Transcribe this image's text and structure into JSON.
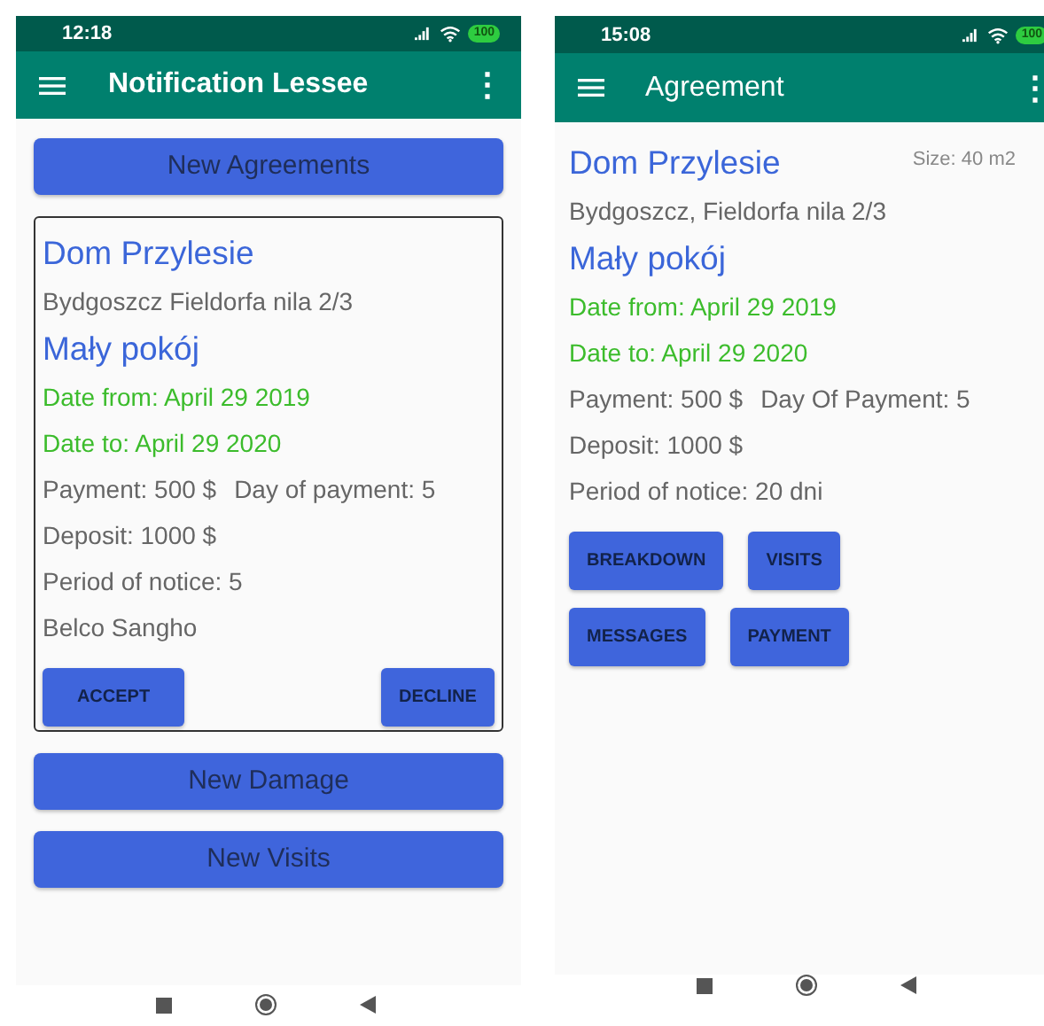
{
  "screens": [
    {
      "kind": "notification",
      "status": {
        "time": "12:18",
        "battery": "100"
      },
      "title": "Notification Lessee",
      "more": "⋮",
      "content": [
        {
          "kind": "wide_button",
          "label": "New Agreements"
        },
        {
          "kind": "card",
          "lines": [
            {
              "kind": "heading",
              "texts": [
                "Dom Przylesie"
              ]
            },
            {
              "kind": "text",
              "texts": [
                "Bydgoszcz Fieldorfa nila 2/3"
              ]
            },
            {
              "kind": "heading",
              "texts": [
                "Mały pokój"
              ]
            },
            {
              "kind": "date",
              "texts": [
                "Date from: April 29 2019"
              ]
            },
            {
              "kind": "date",
              "texts": [
                "Date to: April 29 2020"
              ]
            },
            {
              "kind": "text",
              "texts": [
                "Payment: 500 $",
                "Day of payment: 5"
              ]
            },
            {
              "kind": "text",
              "texts": [
                "Deposit: 1000 $"
              ]
            },
            {
              "kind": "text",
              "texts": [
                "Period of notice: 5"
              ]
            },
            {
              "kind": "text",
              "texts": [
                "Belco Sangho"
              ]
            }
          ],
          "actions": [
            "ACCEPT",
            "DECLINE"
          ]
        },
        {
          "kind": "wide_button",
          "label": "New Damage"
        },
        {
          "kind": "wide_button",
          "label": "New Visits"
        }
      ]
    },
    {
      "kind": "agreement",
      "status": {
        "time": "15:08",
        "battery": "100"
      },
      "title": "Agreement",
      "more": "⋮",
      "content": [
        {
          "kind": "details",
          "size": "Size: 40 m2",
          "lines": [
            {
              "kind": "heading",
              "texts": [
                "Dom Przylesie"
              ]
            },
            {
              "kind": "text",
              "texts": [
                "Bydgoszcz, Fieldorfa nila 2/3"
              ]
            },
            {
              "kind": "heading",
              "texts": [
                "Mały pokój"
              ]
            },
            {
              "kind": "date",
              "texts": [
                "Date from: April 29 2019"
              ]
            },
            {
              "kind": "date",
              "texts": [
                "Date to: April 29 2020"
              ]
            },
            {
              "kind": "text",
              "texts": [
                "Payment: 500 $",
                "Day Of Payment: 5"
              ]
            },
            {
              "kind": "text",
              "texts": [
                "Deposit: 1000 $"
              ]
            },
            {
              "kind": "text",
              "texts": [
                "Period of notice: 20 dni"
              ]
            }
          ],
          "button_rows": [
            [
              "BREAKDOWN",
              "VISITS"
            ],
            [
              "MESSAGES",
              "PAYMENT"
            ]
          ]
        }
      ]
    }
  ]
}
